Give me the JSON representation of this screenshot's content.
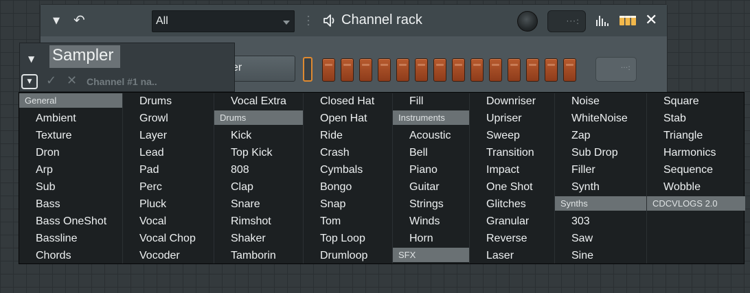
{
  "rack": {
    "filter_value": "All",
    "title": "Channel rack",
    "channel_button_label": "er",
    "step_count": 14
  },
  "sampler": {
    "name": "Sampler",
    "channel_name": "Channel #1 na.."
  },
  "menu": {
    "columns": [
      [
        {
          "type": "header",
          "label": "General"
        },
        {
          "type": "item",
          "label": "Ambient"
        },
        {
          "type": "item",
          "label": "Texture"
        },
        {
          "type": "item",
          "label": "Dron"
        },
        {
          "type": "item",
          "label": "Arp"
        },
        {
          "type": "item",
          "label": "Sub"
        },
        {
          "type": "item",
          "label": "Bass"
        },
        {
          "type": "item",
          "label": "Bass OneShot"
        },
        {
          "type": "item",
          "label": "Bassline"
        },
        {
          "type": "item",
          "label": "Chords"
        }
      ],
      [
        {
          "type": "item",
          "label": "Drums"
        },
        {
          "type": "item",
          "label": "Growl"
        },
        {
          "type": "item",
          "label": "Layer"
        },
        {
          "type": "item",
          "label": "Lead"
        },
        {
          "type": "item",
          "label": "Pad"
        },
        {
          "type": "item",
          "label": "Perc"
        },
        {
          "type": "item",
          "label": "Pluck"
        },
        {
          "type": "item",
          "label": "Vocal"
        },
        {
          "type": "item",
          "label": "Vocal Chop"
        },
        {
          "type": "item",
          "label": "Vocoder"
        }
      ],
      [
        {
          "type": "item",
          "label": "Vocal Extra"
        },
        {
          "type": "header",
          "label": "Drums"
        },
        {
          "type": "item",
          "label": "Kick"
        },
        {
          "type": "item",
          "label": "Top Kick"
        },
        {
          "type": "item",
          "label": "808"
        },
        {
          "type": "item",
          "label": "Clap"
        },
        {
          "type": "item",
          "label": "Snare"
        },
        {
          "type": "item",
          "label": "Rimshot"
        },
        {
          "type": "item",
          "label": "Shaker"
        },
        {
          "type": "item",
          "label": "Tamborin"
        }
      ],
      [
        {
          "type": "item",
          "label": "Closed Hat"
        },
        {
          "type": "item",
          "label": "Open Hat"
        },
        {
          "type": "item",
          "label": "Ride"
        },
        {
          "type": "item",
          "label": "Crash"
        },
        {
          "type": "item",
          "label": "Cymbals"
        },
        {
          "type": "item",
          "label": "Bongo"
        },
        {
          "type": "item",
          "label": "Snap"
        },
        {
          "type": "item",
          "label": "Tom"
        },
        {
          "type": "item",
          "label": "Top Loop"
        },
        {
          "type": "item",
          "label": "Drumloop"
        }
      ],
      [
        {
          "type": "item",
          "label": "Fill"
        },
        {
          "type": "header",
          "label": "Instruments"
        },
        {
          "type": "item",
          "label": "Acoustic"
        },
        {
          "type": "item",
          "label": "Bell"
        },
        {
          "type": "item",
          "label": "Piano"
        },
        {
          "type": "item",
          "label": "Guitar"
        },
        {
          "type": "item",
          "label": "Strings"
        },
        {
          "type": "item",
          "label": "Winds"
        },
        {
          "type": "item",
          "label": "Horn"
        },
        {
          "type": "header",
          "label": "SFX"
        }
      ],
      [
        {
          "type": "item",
          "label": "Downriser"
        },
        {
          "type": "item",
          "label": "Upriser"
        },
        {
          "type": "item",
          "label": "Sweep"
        },
        {
          "type": "item",
          "label": "Transition"
        },
        {
          "type": "item",
          "label": "Impact"
        },
        {
          "type": "item",
          "label": "One Shot"
        },
        {
          "type": "item",
          "label": "Glitches"
        },
        {
          "type": "item",
          "label": "Granular"
        },
        {
          "type": "item",
          "label": "Reverse"
        },
        {
          "type": "item",
          "label": "Laser"
        }
      ],
      [
        {
          "type": "item",
          "label": "Noise"
        },
        {
          "type": "item",
          "label": "WhiteNoise"
        },
        {
          "type": "item",
          "label": "Zap"
        },
        {
          "type": "item",
          "label": "Sub Drop"
        },
        {
          "type": "item",
          "label": "Filler"
        },
        {
          "type": "item",
          "label": "Synth"
        },
        {
          "type": "header",
          "label": "Synths"
        },
        {
          "type": "item",
          "label": "303"
        },
        {
          "type": "item",
          "label": "Saw"
        },
        {
          "type": "item",
          "label": "Sine"
        }
      ],
      [
        {
          "type": "item",
          "label": "Square"
        },
        {
          "type": "item",
          "label": "Stab"
        },
        {
          "type": "item",
          "label": "Triangle"
        },
        {
          "type": "item",
          "label": "Harmonics"
        },
        {
          "type": "item",
          "label": "Sequence"
        },
        {
          "type": "item",
          "label": "Wobble"
        },
        {
          "type": "header",
          "label": "CDCVLOGS 2.0"
        }
      ]
    ]
  },
  "colors": {
    "step_active": "#b75a2e",
    "selection_indicator": "#e08a30",
    "menu_background": "#1c2022",
    "menu_header": "#6a7174"
  }
}
